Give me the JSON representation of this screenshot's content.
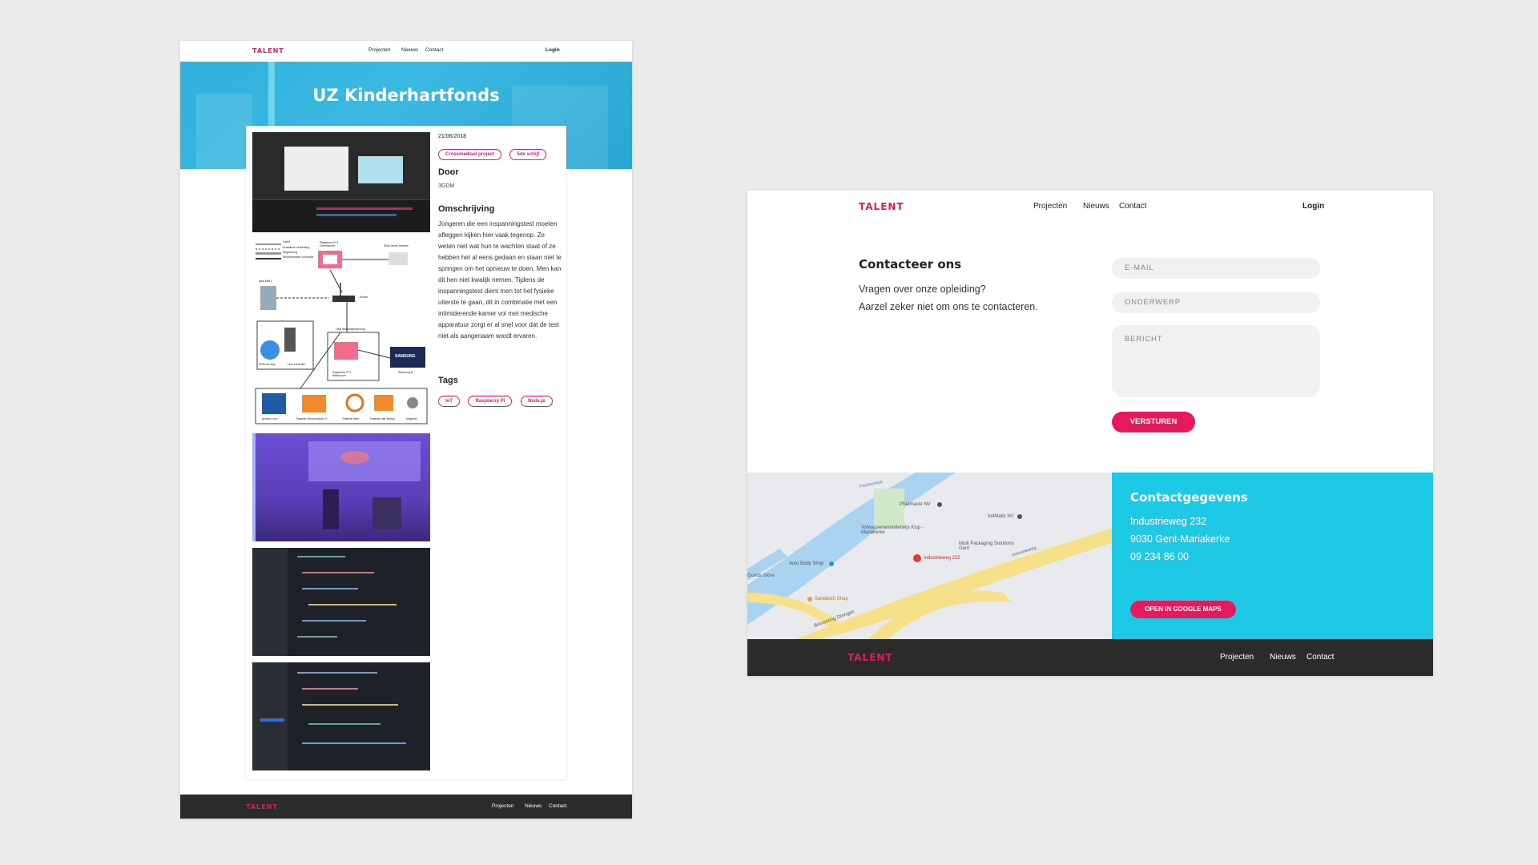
{
  "left_page": {
    "nav": {
      "brand": "TALENT",
      "links": [
        "Projecten",
        "Nieuws",
        "Contact"
      ],
      "login": "Login"
    },
    "hero_title": "UZ Kinderhartfonds",
    "project": {
      "date": "21/06/2018",
      "category_tags": [
        "Crossmediaal project",
        "5de schijf"
      ],
      "door_heading": "Door",
      "door_value": "3GDM",
      "omschrijving_heading": "Omschrijving",
      "omschrijving_text": "Jongeren die een inspanningstest moeten afleggen kijken hier vaak tegenop. Ze weten niet wat hun te wachten staat of ze hebben het al eens gedaan en staan niet te springen om het opnieuw te doen. Men kan dit hen niet kwalijk nemen. Tijdens de inspanningstest dient men tot het fysieke uiterste te gaan, dit in combinatie met een intimiderende kamer vol met medische apparatuur zorgt er al snel voor dat de test niet als aangenaam wordt ervaren.",
      "tags_heading": "Tags",
      "tags": [
        "IoT",
        "Raspberry Pi",
        "Node.js"
      ],
      "diagram_labels": {
        "legend": [
          "Kabel",
          "Draadloze verbinding",
          "Regenboog",
          "Rechtstreekse connectie"
        ],
        "raspberry_top": "Raspberry Pi 3 Client/server",
        "short_throw": "Short throw beamer",
        "ipad": "Ipad Mini 2",
        "router": "Router",
        "led_strip": "RGB led strip",
        "led_controller": "Led- controller",
        "raspberry_bottom": "Raspberry Pi 3 Webserver",
        "usb_remote": "USB afstandsbediening",
        "samsung_brand": "SAMSUNG",
        "samsung_tv": "Samsung tv",
        "components": [
          "Arduino Uno",
          "Tinkerkit Sensorshield V2",
          "Tinkerkit Wire",
          "Tinkerkit Hall Sensor",
          "Magneet"
        ]
      }
    },
    "footer": {
      "brand": "TALENT",
      "links": [
        "Projecten",
        "Nieuws",
        "Contact"
      ]
    }
  },
  "right_page": {
    "nav": {
      "brand": "TALENT",
      "links": [
        "Projecten",
        "Nieuws",
        "Contact"
      ],
      "login": "Login"
    },
    "contact": {
      "title": "Contacteer ons",
      "line1": "Vragen over onze opleiding?",
      "line2": "Aarzel zeker niet om ons te contacteren.",
      "email_placeholder": "E-MAIL",
      "subject_placeholder": "ONDERWERP",
      "message_placeholder": "BERICHT",
      "submit": "VERSTUREN"
    },
    "map_labels": [
      "Pharmacie NV",
      "In4Matic NV",
      "Volwassenenonderwijs Kisp - Mariakerke",
      "Multi Packaging Solutions Gent",
      "Industrieweg 232",
      "Industrieweg",
      "Auto Body Shop",
      "Goods Store",
      "Sandwich Shop",
      "Binnenring Drongen",
      "Pantserkaai"
    ],
    "contact_details": {
      "title": "Contactgegevens",
      "street": "Industrieweg 232",
      "city": "9030 Gent-Mariakerke",
      "phone": "09 234 86 00",
      "maps_button": "OPEN IN GOOGLE MAPS"
    },
    "footer": {
      "brand": "TALENT",
      "links": [
        "Projecten",
        "Nieuws",
        "Contact"
      ]
    }
  },
  "colors": {
    "brand_pink": "#e6195f",
    "hero_blue": "#2fb1dc",
    "contact_cyan": "#1dc9e4",
    "footer_dark": "#2b2b2b",
    "background": "#ebebeb"
  }
}
